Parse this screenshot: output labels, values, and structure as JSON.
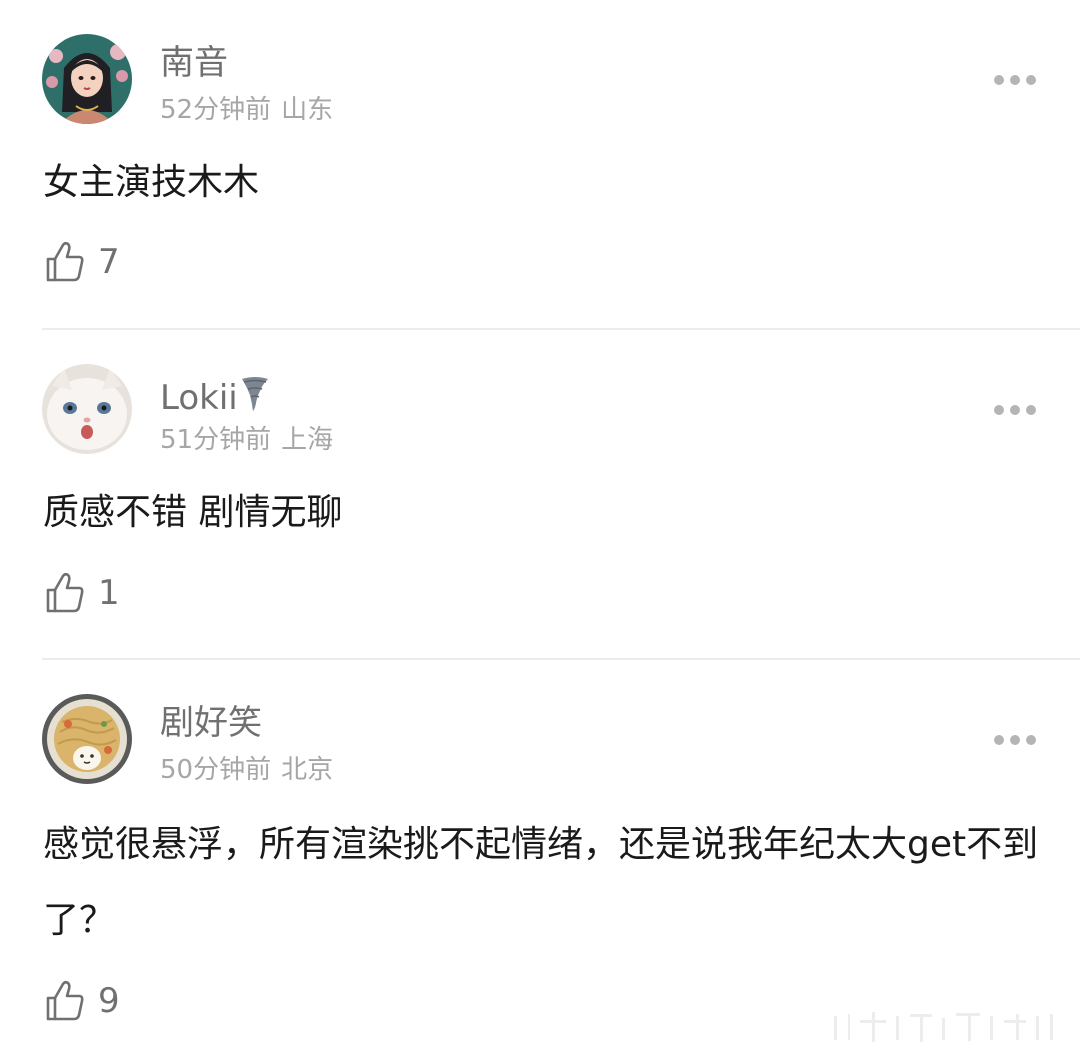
{
  "comments": [
    {
      "username": "南音",
      "time": "52分钟前",
      "location": "山东",
      "text": "女主演技木木",
      "likes": "7",
      "avatar_icon": "girl-illustration-avatar"
    },
    {
      "username": "Lokii",
      "time": "51分钟前",
      "location": "上海",
      "text": "质感不错 剧情无聊",
      "likes": "1",
      "avatar_icon": "white-cat-avatar",
      "badge_icon": "tornado-icon"
    },
    {
      "username": "剧好笑",
      "time": "50分钟前",
      "location": "北京",
      "text": "感觉很悬浮，所有渲染挑不起情绪，还是说我年纪太大get不到了？",
      "likes": "9",
      "avatar_icon": "noodle-bowl-avatar"
    }
  ],
  "colors": {
    "text_primary": "#1a1a1a",
    "text_secondary": "#707070",
    "text_meta": "#a6a6a6",
    "divider": "#ececec"
  }
}
